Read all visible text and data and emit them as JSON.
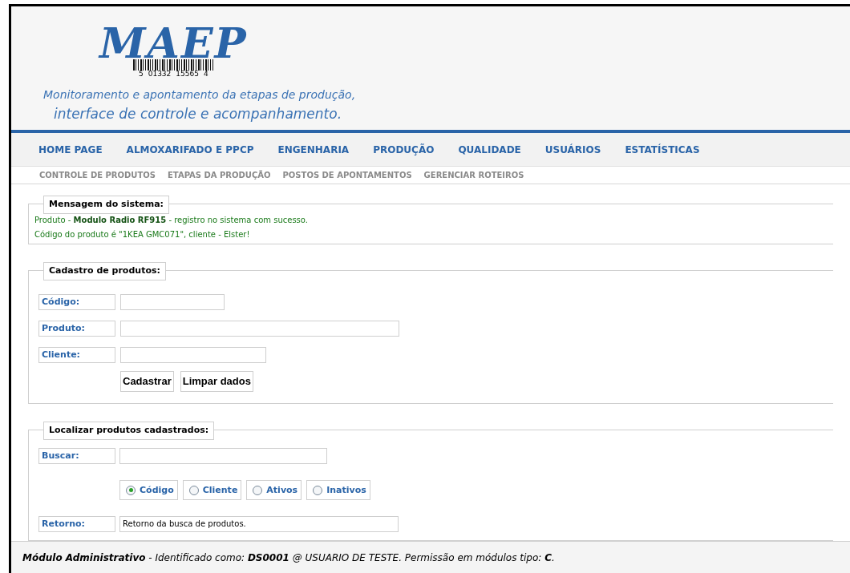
{
  "header": {
    "logo": "MAEP",
    "barcode_digits": [
      "5",
      "01332",
      "15565",
      "4"
    ],
    "tagline": "Monitoramento e apontamento da etapas de produção,",
    "subtitle": "interface de controle e acompanhamento."
  },
  "nav": [
    {
      "label": "HOME PAGE"
    },
    {
      "label": "ALMOXARIFADO E PPCP"
    },
    {
      "label": "ENGENHARIA"
    },
    {
      "label": "PRODUÇÃO"
    },
    {
      "label": "QUALIDADE"
    },
    {
      "label": "USUÁRIOS"
    },
    {
      "label": "ESTATÍSTICAS"
    }
  ],
  "subnav": [
    {
      "label": "CONTROLE DE PRODUTOS"
    },
    {
      "label": "ETAPAS DA PRODUÇÃO"
    },
    {
      "label": "POSTOS DE APONTAMENTOS"
    },
    {
      "label": "GERENCIAR ROTEIROS"
    }
  ],
  "message": {
    "title": "Mensagem do sistema:",
    "lines": [
      "Produto - **Modulo Radio RF915** - registro no sistema com sucesso.",
      "Código do produto é \"1KEA GMC071\", cliente - Elster!"
    ]
  },
  "register": {
    "title": "Cadastro de produtos:",
    "fields": [
      {
        "label": "Código:"
      },
      {
        "label": "Produto:"
      },
      {
        "label": "Cliente:"
      }
    ],
    "buttons": [
      "Cadastrar",
      "Limpar dados"
    ]
  },
  "search": {
    "title": "Localizar produtos cadastrados:",
    "field": {
      "label": "Buscar:"
    },
    "options": [
      {
        "label": "Código",
        "selected": true
      },
      {
        "label": "Cliente",
        "selected": false
      },
      {
        "label": "Ativos",
        "selected": false
      },
      {
        "label": "Inativos",
        "selected": false
      }
    ],
    "result": {
      "label": "Retorno:",
      "value": "Retorno da busca de produtos."
    }
  },
  "footer": "*Módulo Administrativo* - Identificado como: **DS0001** @ USUARIO DE TESTE. Permissão em módulos tipo: **C**."
}
